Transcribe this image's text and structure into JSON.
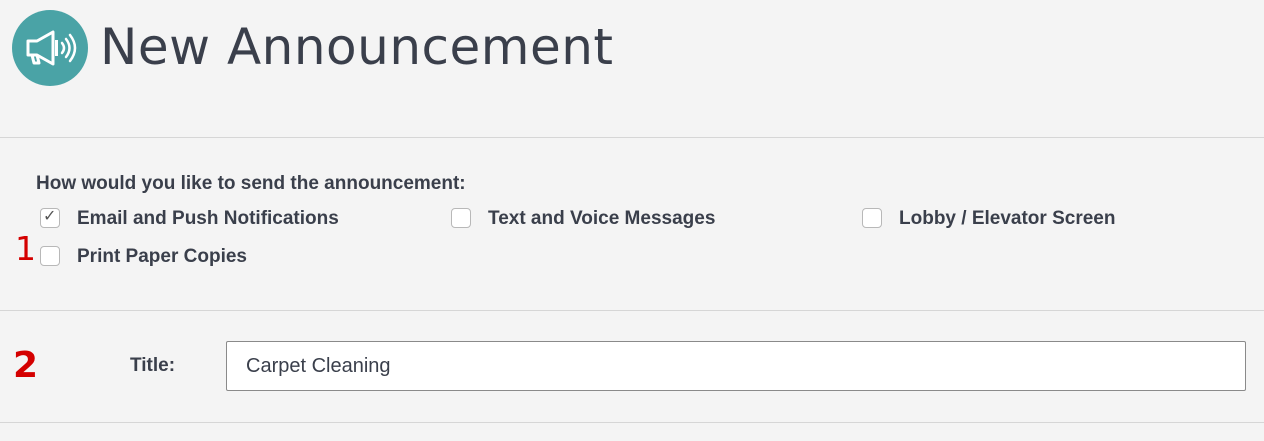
{
  "header": {
    "title": "New Announcement",
    "icon": "megaphone-icon",
    "icon_bg": "#4aa3a6"
  },
  "send_options": {
    "question": "How would you like to send the announcement:",
    "marker": "1",
    "items": [
      {
        "label": "Email and Push Notifications",
        "checked": true
      },
      {
        "label": "Text and Voice Messages",
        "checked": false
      },
      {
        "label": "Lobby / Elevator Screen",
        "checked": false
      },
      {
        "label": "Print Paper Copies",
        "checked": false
      }
    ]
  },
  "title_field": {
    "marker": "2",
    "label": "Title:",
    "value": "Carpet Cleaning"
  },
  "colors": {
    "marker": "#d40000",
    "text": "#3a3f4b",
    "background": "#f4f4f4"
  }
}
